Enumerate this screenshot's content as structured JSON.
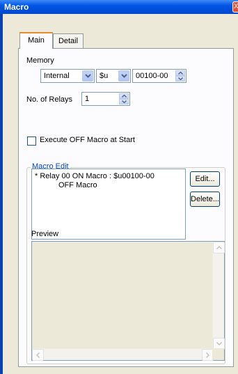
{
  "window": {
    "title": "Macro",
    "close_glyph": "X"
  },
  "tabs": [
    {
      "label": "Main",
      "active": true
    },
    {
      "label": "Detail",
      "active": false
    }
  ],
  "memory": {
    "label": "Memory",
    "type_value": "Internal",
    "prefix_value": "$u",
    "address_value": "00100-00"
  },
  "relays": {
    "label": "No. of Relays",
    "value": "1"
  },
  "execute_off": {
    "label": "Execute OFF Macro at Start",
    "checked": false
  },
  "macro_edit": {
    "title": "Macro Edit",
    "list_lines": [
      "* Relay 00 ON Macro : $u00100-00",
      "OFF Macro"
    ],
    "edit_button": "Edit...",
    "delete_button": "Delete..."
  },
  "preview": {
    "label": "Preview"
  },
  "icons": {
    "dropdown": "chevron-down-icon",
    "spin_up": "spin-up-icon",
    "spin_down": "spin-down-icon",
    "scroll_up": "scroll-up-arrow-icon",
    "scroll_down": "scroll-down-arrow-icon",
    "scroll_left": "scroll-left-arrow-icon",
    "scroll_right": "scroll-right-arrow-icon"
  },
  "colors": {
    "titlebar": "#0055e5",
    "tab_accent": "#e68b2c",
    "group_title": "#0046d5",
    "dialog_bg": "#ece9d8"
  }
}
